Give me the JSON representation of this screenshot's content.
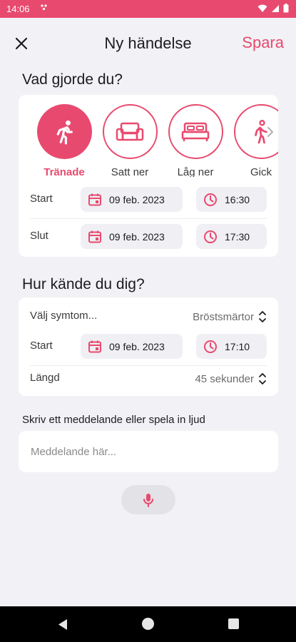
{
  "status_bar": {
    "time": "14:06",
    "notification": "•”"
  },
  "header": {
    "title": "Ny händelse",
    "save_label": "Spara",
    "close_icon": "close-icon"
  },
  "activity_section": {
    "title": "Vad gjorde du?",
    "items": [
      {
        "label": "Tränade",
        "icon": "running-icon",
        "selected": true
      },
      {
        "label": "Satt ner",
        "icon": "sofa-icon",
        "selected": false
      },
      {
        "label": "Låg ner",
        "icon": "bed-icon",
        "selected": false
      },
      {
        "label": "Gick",
        "icon": "walking-icon",
        "selected": false
      }
    ],
    "start": {
      "label": "Start",
      "date": "09 feb. 2023",
      "time": "16:30"
    },
    "end": {
      "label": "Slut",
      "date": "09 feb. 2023",
      "time": "17:30"
    }
  },
  "feeling_section": {
    "title": "Hur kände du dig?",
    "symptom": {
      "label": "Välj symtom...",
      "value": "Bröstsmärtor"
    },
    "start": {
      "label": "Start",
      "date": "09 feb. 2023",
      "time": "17:10"
    },
    "duration": {
      "label": "Längd",
      "value": "45 sekunder"
    }
  },
  "message": {
    "label": "Skriv ett meddelande eller spela in ljud",
    "placeholder": "Meddelande här..."
  },
  "colors": {
    "accent": "#e84a6f",
    "background": "#f2f1f5",
    "card": "#ffffff",
    "pill": "#f0eff4"
  }
}
